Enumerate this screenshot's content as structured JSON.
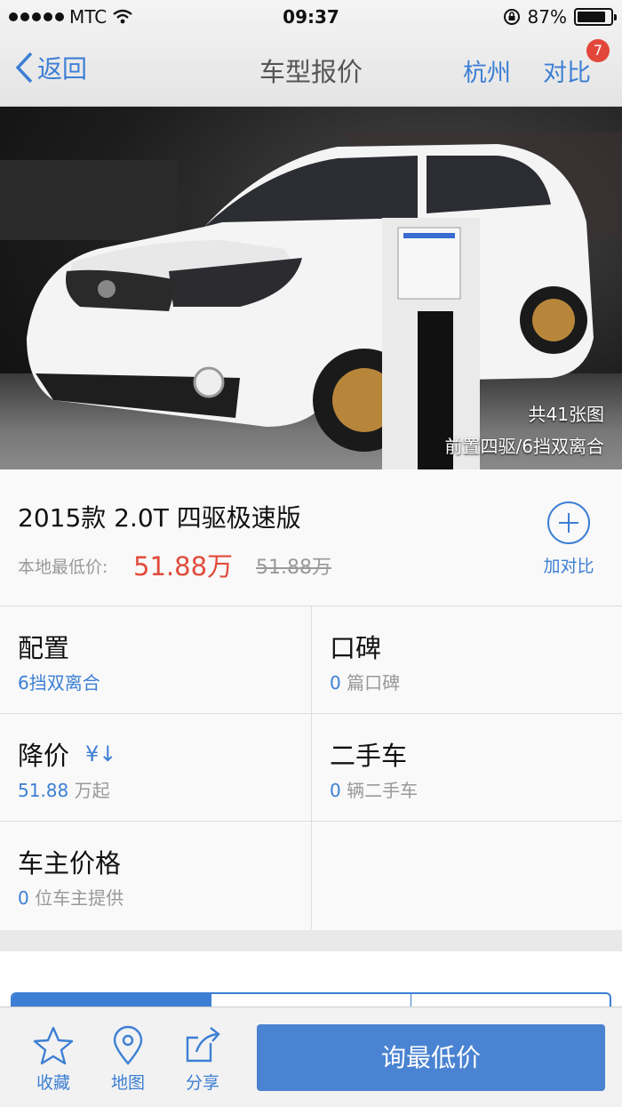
{
  "status_bar": {
    "carrier": "MTC",
    "time": "09:37",
    "battery": "87%",
    "battery_level": 0.87
  },
  "nav": {
    "back_label": "返回",
    "title": "车型报价",
    "city": "杭州",
    "compare_label": "对比",
    "compare_count": "7"
  },
  "hero": {
    "photo_count": "共41张图",
    "caption": "前置四驱/6挡双离合"
  },
  "model": {
    "name": "2015款 2.0T 四驱极速版",
    "price_label": "本地最低价:",
    "price": "51.88万",
    "original_price": "51.88万",
    "add_compare_label": "加对比"
  },
  "grid": {
    "config": {
      "title": "配置",
      "sub": "6挡双离合"
    },
    "reviews": {
      "title": "口碑",
      "count": "0",
      "suffix": " 篇口碑"
    },
    "price_cut": {
      "title": "降价",
      "icon": "¥↓",
      "count": "51.88",
      "suffix": " 万起"
    },
    "used": {
      "title": "二手车",
      "count": "0",
      "suffix": " 辆二手车"
    },
    "owner_price": {
      "title": "车主价格",
      "count": "0",
      "suffix": " 位车主提供"
    }
  },
  "bottom": {
    "favorite": "收藏",
    "map": "地图",
    "share": "分享",
    "inquire": "询最低价"
  },
  "colors": {
    "accent": "#3d7fd4",
    "price_red": "#e14b3b",
    "badge_red": "#e2473a",
    "button_blue": "#4a83d2"
  }
}
